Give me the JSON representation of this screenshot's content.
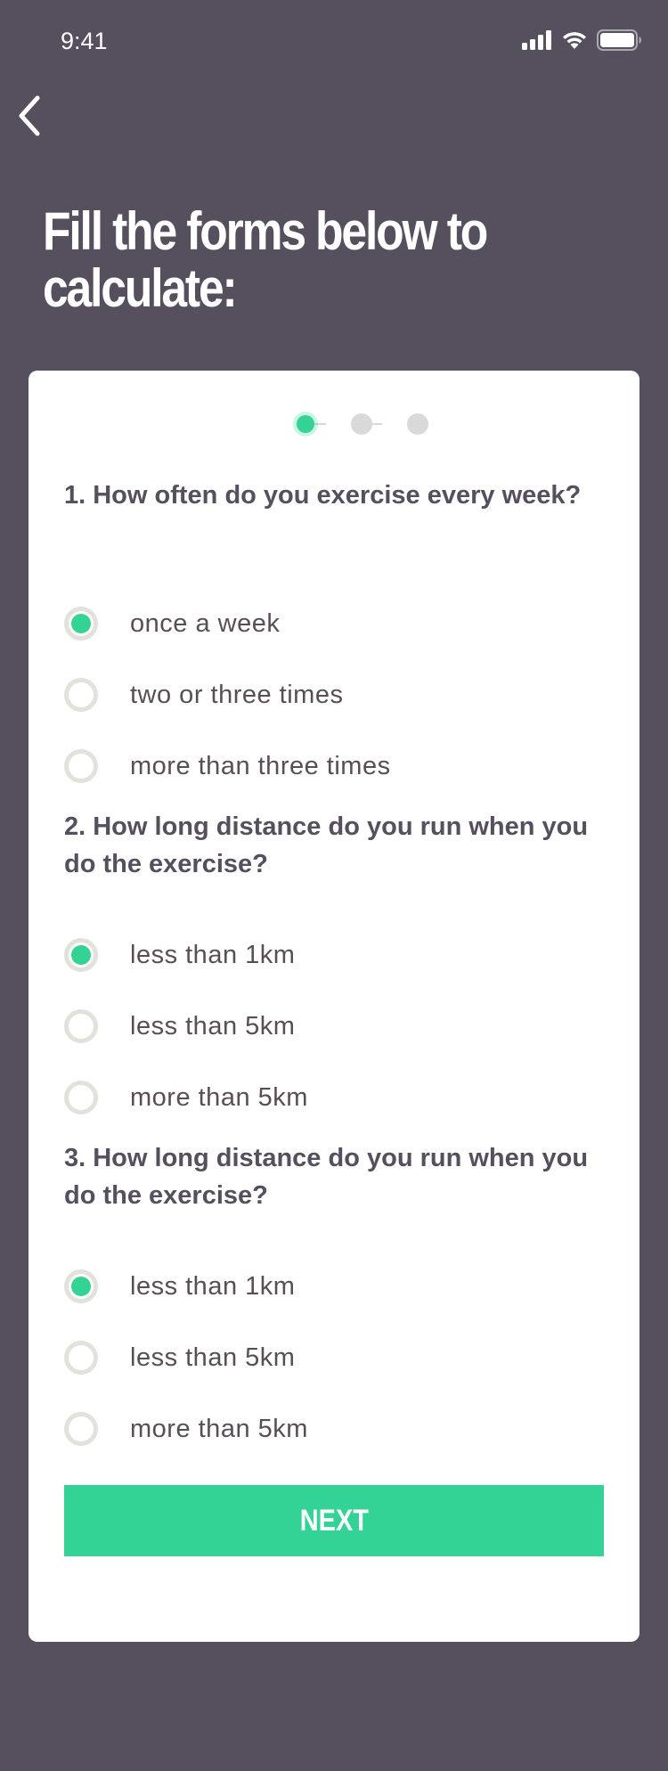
{
  "status_bar": {
    "time": "9:41",
    "icons": [
      "signal-icon",
      "wifi-icon",
      "battery-icon"
    ]
  },
  "nav": {
    "back_icon": "chevron-left-icon"
  },
  "title": "Fill the forms below to calculate:",
  "stepper": {
    "total_steps": 3,
    "current_step": 1
  },
  "questions": [
    {
      "text": "1. How often do you exercise every week?",
      "options": [
        {
          "label": "once a week",
          "selected": true
        },
        {
          "label": "two or three times",
          "selected": false
        },
        {
          "label": "more than three times",
          "selected": false
        }
      ]
    },
    {
      "text": "2. How long distance do you run when you do the exercise?",
      "options": [
        {
          "label": "less than 1km",
          "selected": true
        },
        {
          "label": "less than 5km",
          "selected": false
        },
        {
          "label": "more than 5km",
          "selected": false
        }
      ]
    },
    {
      "text": "3. How long distance do you run when you do the exercise?",
      "options": [
        {
          "label": "less than 1km",
          "selected": true
        },
        {
          "label": "less than 5km",
          "selected": false
        },
        {
          "label": "more than 5km",
          "selected": false
        }
      ]
    }
  ],
  "next_button": {
    "label": "NEXT"
  },
  "colors": {
    "background": "#564f5e",
    "accent": "#32d394",
    "card": "#ffffff",
    "text_dark": "#564f5e",
    "radio_border": "#e2e1dc",
    "stepper_inactive": "#d9d9d9"
  }
}
